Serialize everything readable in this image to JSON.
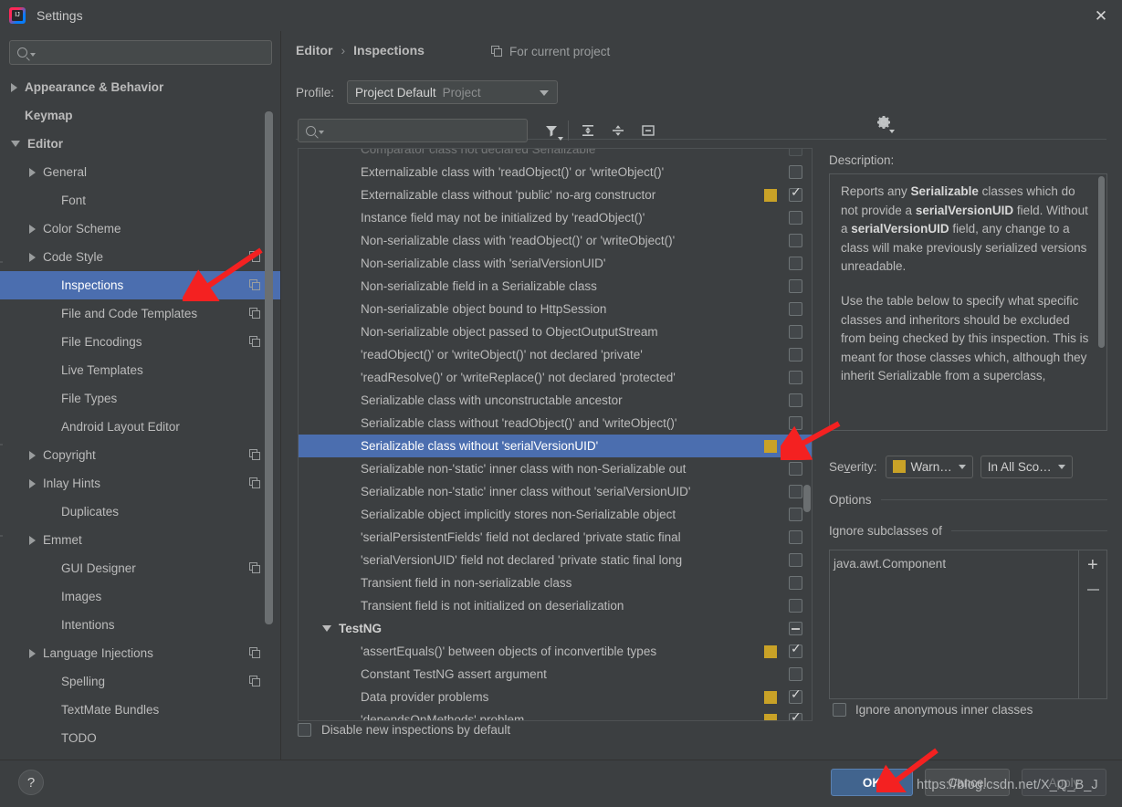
{
  "window": {
    "title": "Settings",
    "logo_icon": "intellij-idea-logo",
    "close_icon": "close-icon"
  },
  "sidebar": {
    "search": {
      "placeholder": "",
      "value": "",
      "icon": "search-icon"
    },
    "items": [
      {
        "label": "Appearance & Behavior",
        "indent": 0,
        "twisty": "collapsed",
        "bold": true,
        "copy": false,
        "selected": false
      },
      {
        "label": "Keymap",
        "indent": 0,
        "twisty": "none",
        "bold": true,
        "copy": false,
        "selected": false
      },
      {
        "label": "Editor",
        "indent": 0,
        "twisty": "expanded",
        "bold": true,
        "copy": false,
        "selected": false
      },
      {
        "label": "General",
        "indent": 1,
        "twisty": "collapsed",
        "bold": false,
        "copy": false,
        "selected": false
      },
      {
        "label": "Font",
        "indent": 2,
        "twisty": "none",
        "bold": false,
        "copy": false,
        "selected": false
      },
      {
        "label": "Color Scheme",
        "indent": 1,
        "twisty": "collapsed",
        "bold": false,
        "copy": false,
        "selected": false
      },
      {
        "label": "Code Style",
        "indent": 1,
        "twisty": "collapsed",
        "bold": false,
        "copy": true,
        "selected": false
      },
      {
        "label": "Inspections",
        "indent": 2,
        "twisty": "none",
        "bold": false,
        "copy": true,
        "selected": true
      },
      {
        "label": "File and Code Templates",
        "indent": 2,
        "twisty": "none",
        "bold": false,
        "copy": true,
        "selected": false
      },
      {
        "label": "File Encodings",
        "indent": 2,
        "twisty": "none",
        "bold": false,
        "copy": true,
        "selected": false
      },
      {
        "label": "Live Templates",
        "indent": 2,
        "twisty": "none",
        "bold": false,
        "copy": false,
        "selected": false
      },
      {
        "label": "File Types",
        "indent": 2,
        "twisty": "none",
        "bold": false,
        "copy": false,
        "selected": false
      },
      {
        "label": "Android Layout Editor",
        "indent": 2,
        "twisty": "none",
        "bold": false,
        "copy": false,
        "selected": false
      },
      {
        "label": "Copyright",
        "indent": 1,
        "twisty": "collapsed",
        "bold": false,
        "copy": true,
        "selected": false
      },
      {
        "label": "Inlay Hints",
        "indent": 1,
        "twisty": "collapsed",
        "bold": false,
        "copy": true,
        "selected": false
      },
      {
        "label": "Duplicates",
        "indent": 2,
        "twisty": "none",
        "bold": false,
        "copy": false,
        "selected": false
      },
      {
        "label": "Emmet",
        "indent": 1,
        "twisty": "collapsed",
        "bold": false,
        "copy": false,
        "selected": false
      },
      {
        "label": "GUI Designer",
        "indent": 2,
        "twisty": "none",
        "bold": false,
        "copy": true,
        "selected": false
      },
      {
        "label": "Images",
        "indent": 2,
        "twisty": "none",
        "bold": false,
        "copy": false,
        "selected": false
      },
      {
        "label": "Intentions",
        "indent": 2,
        "twisty": "none",
        "bold": false,
        "copy": false,
        "selected": false
      },
      {
        "label": "Language Injections",
        "indent": 1,
        "twisty": "collapsed",
        "bold": false,
        "copy": true,
        "selected": false
      },
      {
        "label": "Spelling",
        "indent": 2,
        "twisty": "none",
        "bold": false,
        "copy": true,
        "selected": false
      },
      {
        "label": "TextMate Bundles",
        "indent": 2,
        "twisty": "none",
        "bold": false,
        "copy": false,
        "selected": false
      },
      {
        "label": "TODO",
        "indent": 2,
        "twisty": "none",
        "bold": false,
        "copy": false,
        "selected": false
      }
    ]
  },
  "main": {
    "breadcrumb": {
      "parent": "Editor",
      "separator": "›",
      "current": "Inspections"
    },
    "for_current_project": "For current project",
    "for_current_project_icon": "copy-icon",
    "profile": {
      "label": "Profile:",
      "value": "Project Default",
      "scope": "Project",
      "caret_icon": "chevron-down-icon"
    },
    "gear_icon": "gear-icon",
    "toolbar": {
      "search": {
        "placeholder": "",
        "value": "",
        "icon": "search-icon"
      },
      "filter_icon": "filter-icon",
      "expand_all_icon": "expand-all-icon",
      "collapse_all_icon": "collapse-all-icon",
      "minimize_icon": "minimize-icon"
    },
    "disable_new_inspections": {
      "label": "Disable new inspections by default",
      "checked": false
    }
  },
  "inspections": [
    {
      "label": "Comparator class not declared Serializable",
      "group": false,
      "severity": false,
      "state": "off",
      "selected": false,
      "clipped_top": true
    },
    {
      "label": "Externalizable class with 'readObject()' or 'writeObject()'",
      "group": false,
      "severity": false,
      "state": "off",
      "selected": false
    },
    {
      "label": "Externalizable class without 'public' no-arg constructor",
      "group": false,
      "severity": true,
      "state": "on",
      "selected": false
    },
    {
      "label": "Instance field may not be initialized by 'readObject()'",
      "group": false,
      "severity": false,
      "state": "off",
      "selected": false
    },
    {
      "label": "Non-serializable class with 'readObject()' or 'writeObject()'",
      "group": false,
      "severity": false,
      "state": "off",
      "selected": false
    },
    {
      "label": "Non-serializable class with 'serialVersionUID'",
      "group": false,
      "severity": false,
      "state": "off",
      "selected": false
    },
    {
      "label": "Non-serializable field in a Serializable class",
      "group": false,
      "severity": false,
      "state": "off",
      "selected": false
    },
    {
      "label": "Non-serializable object bound to HttpSession",
      "group": false,
      "severity": false,
      "state": "off",
      "selected": false
    },
    {
      "label": "Non-serializable object passed to ObjectOutputStream",
      "group": false,
      "severity": false,
      "state": "off",
      "selected": false
    },
    {
      "label": "'readObject()' or 'writeObject()' not declared 'private'",
      "group": false,
      "severity": false,
      "state": "off",
      "selected": false
    },
    {
      "label": "'readResolve()' or 'writeReplace()' not declared 'protected'",
      "group": false,
      "severity": false,
      "state": "off",
      "selected": false
    },
    {
      "label": "Serializable class with unconstructable ancestor",
      "group": false,
      "severity": false,
      "state": "off",
      "selected": false
    },
    {
      "label": "Serializable class without 'readObject()' and 'writeObject()'",
      "group": false,
      "severity": false,
      "state": "off",
      "selected": false
    },
    {
      "label": "Serializable class without 'serialVersionUID'",
      "group": false,
      "severity": true,
      "state": "on",
      "selected": true
    },
    {
      "label": "Serializable non-'static' inner class with non-Serializable out",
      "group": false,
      "severity": false,
      "state": "off",
      "selected": false
    },
    {
      "label": "Serializable non-'static' inner class without 'serialVersionUID'",
      "group": false,
      "severity": false,
      "state": "off",
      "selected": false
    },
    {
      "label": "Serializable object implicitly stores non-Serializable object",
      "group": false,
      "severity": false,
      "state": "off",
      "selected": false
    },
    {
      "label": "'serialPersistentFields' field not declared 'private static final",
      "group": false,
      "severity": false,
      "state": "off",
      "selected": false
    },
    {
      "label": "'serialVersionUID' field not declared 'private static final long",
      "group": false,
      "severity": false,
      "state": "off",
      "selected": false
    },
    {
      "label": "Transient field in non-serializable class",
      "group": false,
      "severity": false,
      "state": "off",
      "selected": false
    },
    {
      "label": "Transient field is not initialized on deserialization",
      "group": false,
      "severity": false,
      "state": "off",
      "selected": false
    },
    {
      "label": "TestNG",
      "group": true,
      "severity": false,
      "state": "dash",
      "selected": false
    },
    {
      "label": "'assertEquals()' between objects of inconvertible types",
      "group": false,
      "severity": true,
      "state": "on",
      "selected": false
    },
    {
      "label": "Constant TestNG assert argument",
      "group": false,
      "severity": false,
      "state": "off",
      "selected": false
    },
    {
      "label": "Data provider problems",
      "group": false,
      "severity": true,
      "state": "on",
      "selected": false
    },
    {
      "label": "'dependsOnMethods' problem",
      "group": false,
      "severity": true,
      "state": "on",
      "selected": false,
      "clipped_bottom": true
    }
  ],
  "description": {
    "label": "Description:",
    "paragraphs": [
      [
        {
          "t": "Reports any ",
          "b": false
        },
        {
          "t": "Serializable",
          "b": true
        },
        {
          "t": " classes which do not provide a ",
          "b": false
        },
        {
          "t": "serialVersionUID",
          "b": true
        },
        {
          "t": " field. Without a ",
          "b": false
        },
        {
          "t": "serialVersionUID",
          "b": true
        },
        {
          "t": " field, any change to a class will make previously serialized versions unreadable.",
          "b": false
        }
      ],
      [
        {
          "t": "Use the table below to specify what specific classes and inheritors should be excluded from being checked by this inspection. This is meant for those classes which, although they inherit Serializable from a superclass,",
          "b": false
        }
      ]
    ]
  },
  "options": {
    "severity_label": "Severity:",
    "severity_value": "Warn…",
    "severity_color": "#c9a227",
    "scope_value": "In All Sco…",
    "options_title": "Options",
    "ignore_subclasses_title": "Ignore subclasses of",
    "ignore_list": [
      "java.awt.Component"
    ],
    "add_icon": "plus-icon",
    "remove_icon": "minus-icon",
    "ignore_anonymous": {
      "label": "Ignore anonymous inner classes",
      "checked": false
    }
  },
  "footer": {
    "help_label": "?",
    "ok_label": "OK",
    "cancel_label": "Cancel",
    "apply_label": "Apply",
    "watermark": "https://blog.csdn.net/X_Q_B_J"
  },
  "accent": {
    "selection_blue": "#4b6eaf",
    "severity_yellow": "#c9a227",
    "arrow_red": "#f42121"
  }
}
